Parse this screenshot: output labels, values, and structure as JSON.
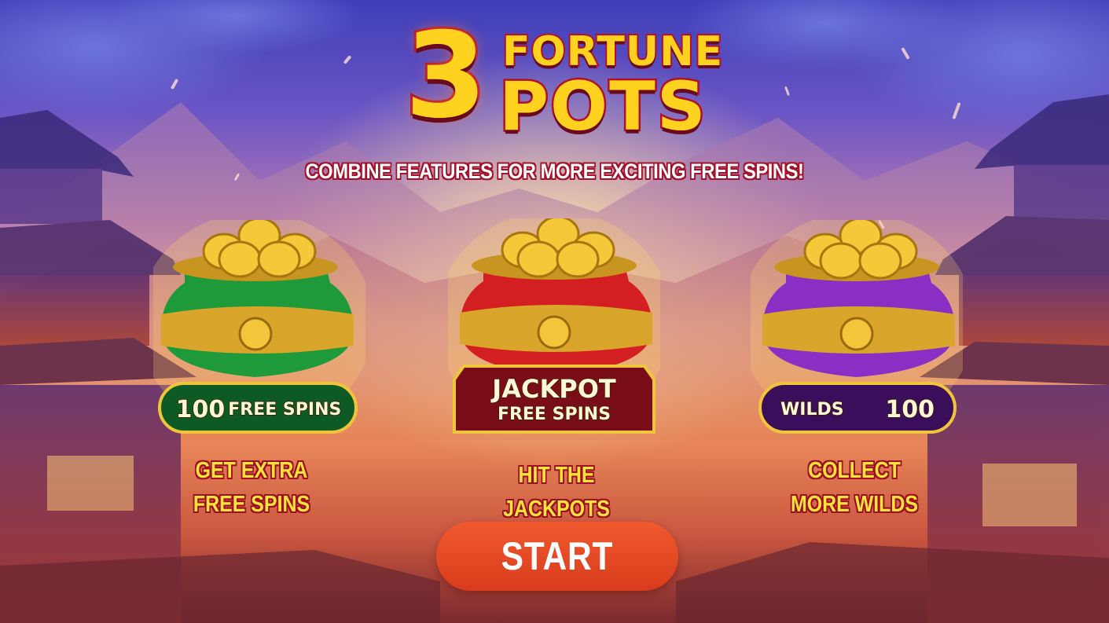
{
  "game": {
    "logo_number": "3",
    "logo_word_top": "FORTUNE",
    "logo_word_bottom": "POTS"
  },
  "subtitle": "COMBINE FEATURES FOR MORE EXCITING FREE SPINS!",
  "pots": [
    {
      "color": "#1f9a3a",
      "plaque_number": "100",
      "plaque_text": "FREE SPINS",
      "feature_line1": "GET EXTRA",
      "feature_line2": "FREE SPINS"
    },
    {
      "color": "#d41f22",
      "plaque_text_line1": "JACKPOT",
      "plaque_text_line2": "FREE SPINS",
      "feature_line1": "HIT THE JACKPOTS"
    },
    {
      "color": "#8a2fc4",
      "plaque_text": "WILDS",
      "plaque_number": "100",
      "feature_line1": "COLLECT",
      "feature_line2": "MORE WILDS"
    }
  ],
  "start_button": "START",
  "colors": {
    "gold": "#ffd21f",
    "outline_red": "#b0102a",
    "feature_text": "#ffe23a",
    "start_bg": "#e6481f"
  }
}
